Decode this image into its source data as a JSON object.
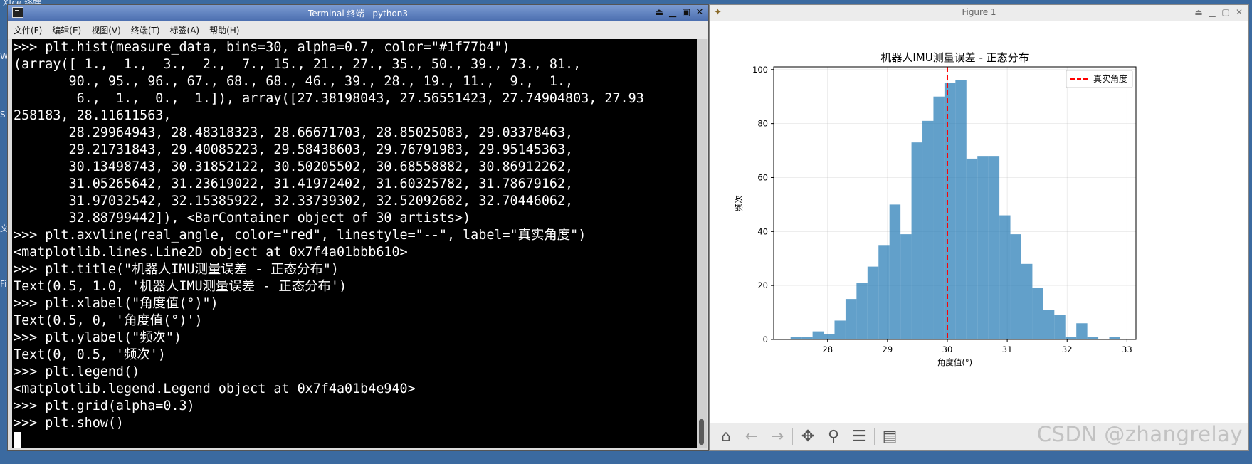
{
  "desktop": {
    "top_label": "Xfce 终端",
    "side_labels": [
      "W",
      "S",
      "文",
      "Fi"
    ]
  },
  "terminal": {
    "title": "Terminal 终端 - python3",
    "menu": [
      "文件(F)",
      "编辑(E)",
      "视图(V)",
      "终端(T)",
      "标签(A)",
      "帮助(H)"
    ],
    "lines": [
      ">>> plt.hist(measure_data, bins=30, alpha=0.7, color=\"#1f77b4\")",
      "(array([ 1.,  1.,  3.,  2.,  7., 15., 21., 27., 35., 50., 39., 73., 81.,",
      "       90., 95., 96., 67., 68., 68., 46., 39., 28., 19., 11.,  9.,  1.,",
      "        6.,  1.,  0.,  1.]), array([27.38198043, 27.56551423, 27.74904803, 27.93",
      "258183, 28.11611563,",
      "       28.29964943, 28.48318323, 28.66671703, 28.85025083, 29.03378463,",
      "       29.21731843, 29.40085223, 29.58438603, 29.76791983, 29.95145363,",
      "       30.13498743, 30.31852122, 30.50205502, 30.68558882, 30.86912262,",
      "       31.05265642, 31.23619022, 31.41972402, 31.60325782, 31.78679162,",
      "       31.97032542, 32.15385922, 32.33739302, 32.52092682, 32.70446062,",
      "       32.88799442]), <BarContainer object of 30 artists>)",
      ">>> plt.axvline(real_angle, color=\"red\", linestyle=\"--\", label=\"真实角度\")",
      "<matplotlib.lines.Line2D object at 0x7f4a01bbb610>",
      ">>> plt.title(\"机器人IMU测量误差 - 正态分布\")",
      "Text(0.5, 1.0, '机器人IMU测量误差 - 正态分布')",
      ">>> plt.xlabel(\"角度值(°)\")",
      "Text(0.5, 0, '角度值(°)')",
      ">>> plt.ylabel(\"频次\")",
      "Text(0, 0.5, '频次')",
      ">>> plt.legend()",
      "<matplotlib.legend.Legend object at 0x7f4a01b4e940>",
      ">>> plt.grid(alpha=0.3)",
      ">>> plt.show()"
    ]
  },
  "figure": {
    "title": "Figure 1",
    "toolbar_icons": [
      "home-icon",
      "back-arrow-icon",
      "forward-arrow-icon",
      "pan-icon",
      "zoom-icon",
      "configure-subplots-icon",
      "save-icon"
    ],
    "watermark": "CSDN @zhangrelay"
  },
  "chart_data": {
    "type": "bar",
    "title": "机器人IMU测量误差 - 正态分布",
    "xlabel": "角度值(°)",
    "ylabel": "频次",
    "bin_edges": [
      27.38198043,
      27.56551423,
      27.74904803,
      27.93258183,
      28.11611563,
      28.29964943,
      28.48318323,
      28.66671703,
      28.85025083,
      29.03378463,
      29.21731843,
      29.40085223,
      29.58438603,
      29.76791983,
      29.95145363,
      30.13498743,
      30.31852122,
      30.50205502,
      30.68558882,
      30.86912262,
      31.05265642,
      31.23619022,
      31.41972402,
      31.60325782,
      31.78679162,
      31.97032542,
      32.15385922,
      32.33739302,
      32.52092682,
      32.70446062,
      32.88799442
    ],
    "values": [
      1,
      1,
      3,
      2,
      7,
      15,
      21,
      27,
      35,
      50,
      39,
      73,
      81,
      90,
      95,
      96,
      67,
      68,
      68,
      46,
      39,
      28,
      19,
      11,
      9,
      1,
      6,
      1,
      0,
      1
    ],
    "bar_color": "#1f77b4",
    "alpha": 0.7,
    "vline": {
      "x": 30.0,
      "color": "#ff0000",
      "linestyle": "--",
      "label": "真实角度"
    },
    "xlim": [
      27.1,
      33.15
    ],
    "ylim": [
      0,
      101
    ],
    "xticks": [
      28,
      29,
      30,
      31,
      32,
      33
    ],
    "yticks": [
      0,
      20,
      40,
      60,
      80,
      100
    ],
    "grid": true,
    "legend_loc": "upper right"
  }
}
